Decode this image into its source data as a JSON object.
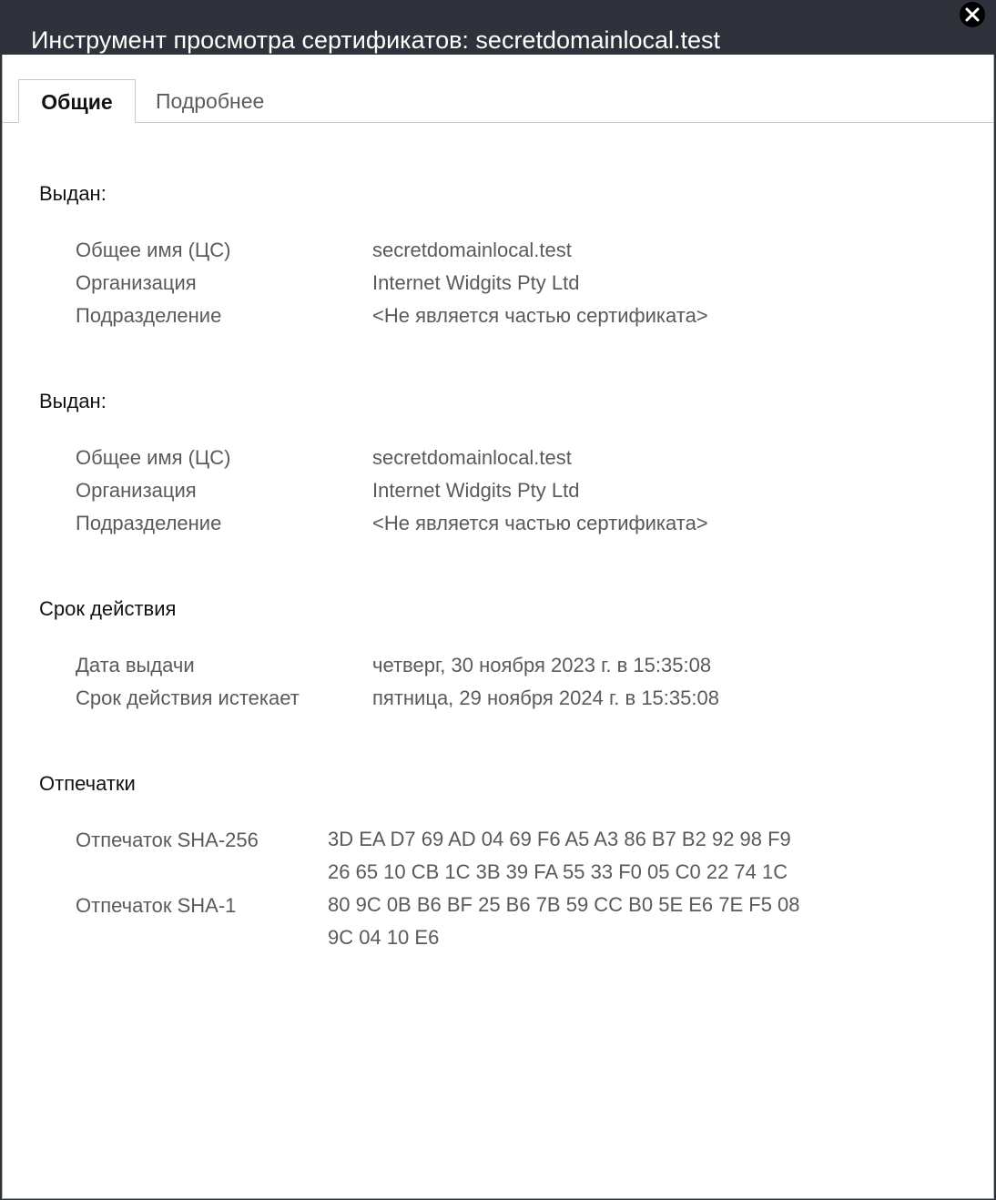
{
  "window": {
    "title": "Инструмент просмотра сертификатов: secretdomainlocal.test",
    "close_icon": "close-icon"
  },
  "tabs": [
    {
      "label": "Общие",
      "selected": true
    },
    {
      "label": "Подробнее",
      "selected": false
    }
  ],
  "subject": {
    "heading": "Выдан:",
    "rows": [
      {
        "label": "Общее имя (ЦС)",
        "value": "secretdomainlocal.test"
      },
      {
        "label": "Организация",
        "value": "Internet Widgits Pty Ltd"
      },
      {
        "label": "Подразделение",
        "value": "<Не является частью сертификата>"
      }
    ]
  },
  "issuer": {
    "heading": "Выдан:",
    "rows": [
      {
        "label": "Общее имя (ЦС)",
        "value": "secretdomainlocal.test"
      },
      {
        "label": "Организация",
        "value": "Internet Widgits Pty Ltd"
      },
      {
        "label": "Подразделение",
        "value": "<Не является частью сертификата>"
      }
    ]
  },
  "validity": {
    "heading": "Срок действия",
    "rows": [
      {
        "label": "Дата выдачи",
        "value": "четверг, 30 ноября 2023 г. в 15:35:08"
      },
      {
        "label": "Срок действия истекает",
        "value": "пятница, 29 ноября 2024 г. в 15:35:08"
      }
    ]
  },
  "fingerprints": {
    "heading": "Отпечатки",
    "sha256": {
      "label": "Отпечаток SHA-256",
      "line1": "3D EA D7 69 AD 04 69 F6 A5 A3 86 B7 B2 92 98 F9",
      "line2": "26 65 10 CB 1C 3B 39 FA 55 33 F0 05 C0 22 74 1C"
    },
    "sha1": {
      "label": "Отпечаток SHA-1",
      "line1": "80 9C 0B B6 BF 25 B6 7B 59 CC B0 5E E6 7E F5 08",
      "line2": "9C 04 10 E6"
    }
  }
}
